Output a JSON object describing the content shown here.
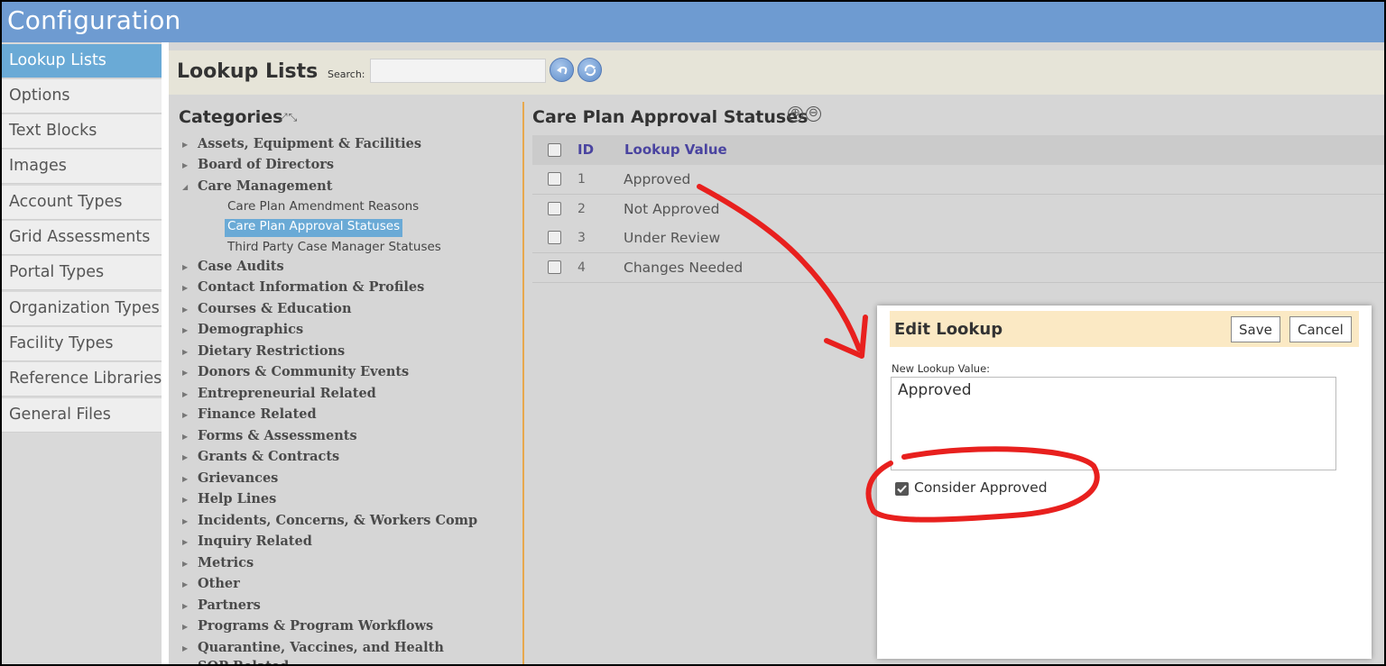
{
  "app": {
    "title": "Configuration"
  },
  "sidebar": {
    "items": [
      {
        "label": "Lookup Lists",
        "active": true
      },
      {
        "label": "Options"
      },
      {
        "label": "Text Blocks"
      },
      {
        "label": "Images"
      },
      {
        "label": "Account Types"
      },
      {
        "label": "Grid Assessments"
      },
      {
        "label": "Portal Types"
      },
      {
        "label": "Organization Types"
      },
      {
        "label": "Facility Types"
      },
      {
        "label": "Reference Libraries"
      },
      {
        "label": "General Files"
      }
    ]
  },
  "toolbar": {
    "title": "Lookup Lists",
    "search_label": "Search:",
    "search_value": "",
    "icons": [
      "back-icon",
      "refresh-icon"
    ]
  },
  "categories": {
    "title": "Categories",
    "expand_icons": "⤢⤡",
    "items": [
      {
        "label": "Assets, Equipment & Facilities",
        "expanded": false
      },
      {
        "label": "Board of Directors",
        "expanded": false
      },
      {
        "label": "Care Management",
        "expanded": true
      },
      {
        "label": "Case Audits",
        "expanded": false
      },
      {
        "label": "Contact Information & Profiles",
        "expanded": false
      },
      {
        "label": "Courses & Education",
        "expanded": false
      },
      {
        "label": "Demographics",
        "expanded": false
      },
      {
        "label": "Dietary Restrictions",
        "expanded": false
      },
      {
        "label": "Donors & Community Events",
        "expanded": false
      },
      {
        "label": "Entrepreneurial Related",
        "expanded": false
      },
      {
        "label": "Finance Related",
        "expanded": false
      },
      {
        "label": "Forms & Assessments",
        "expanded": false
      },
      {
        "label": "Grants & Contracts",
        "expanded": false
      },
      {
        "label": "Grievances",
        "expanded": false
      },
      {
        "label": "Help Lines",
        "expanded": false
      },
      {
        "label": "Incidents, Concerns, & Workers Comp",
        "expanded": false
      },
      {
        "label": "Inquiry Related",
        "expanded": false
      },
      {
        "label": "Metrics",
        "expanded": false
      },
      {
        "label": "Other",
        "expanded": false
      },
      {
        "label": "Partners",
        "expanded": false
      },
      {
        "label": "Programs & Program Workflows",
        "expanded": false
      },
      {
        "label": "Quarantine, Vaccines, and Health",
        "expanded": false
      },
      {
        "label": "SOP Related",
        "expanded": false
      }
    ],
    "care_management_children": [
      {
        "label": "Care Plan Amendment Reasons",
        "selected": false
      },
      {
        "label": "Care Plan Approval Statuses",
        "selected": true
      },
      {
        "label": "Third Party Case Manager Statuses",
        "selected": false
      }
    ]
  },
  "lookup_list": {
    "title": "Care Plan Approval Statuses",
    "add_icon": "⊕",
    "remove_icon": "⊖",
    "columns": {
      "id": "ID",
      "value": "Lookup Value"
    },
    "rows": [
      {
        "id": "1",
        "value": "Approved"
      },
      {
        "id": "2",
        "value": "Not Approved"
      },
      {
        "id": "3",
        "value": "Under Review"
      },
      {
        "id": "4",
        "value": "Changes Needed"
      }
    ]
  },
  "edit_dialog": {
    "title": "Edit Lookup",
    "save_label": "Save",
    "cancel_label": "Cancel",
    "field_label": "New Lookup Value:",
    "field_value": "Approved",
    "checkbox_label": "Consider Approved",
    "checkbox_checked": true
  },
  "colors": {
    "header_bg": "#6e9bd1",
    "active_item": "#6aaad6",
    "annotation_red": "#e8201e",
    "divider": "#e8a94e",
    "dialog_header": "#fbe9c4"
  }
}
